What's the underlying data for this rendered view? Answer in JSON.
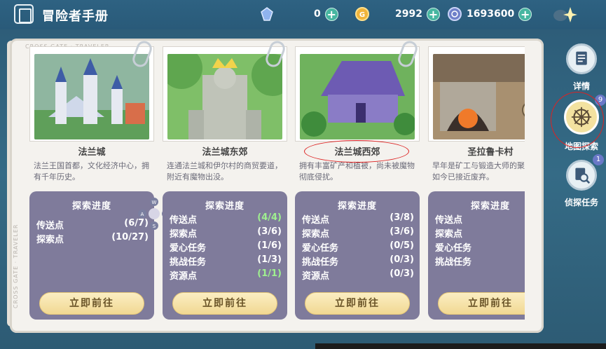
{
  "header": {
    "title": "冒险者手册",
    "resources": [
      {
        "icon": "crystal-icon",
        "value": "0"
      },
      {
        "icon": "gold-coin-icon",
        "value": "2992"
      },
      {
        "icon": "silver-coin-icon",
        "value": "1693600"
      }
    ]
  },
  "watermark": "CROSS GATE · TRAVELER",
  "labels": {
    "progress": "探索进度",
    "go": "立即前往"
  },
  "cards": [
    {
      "name": "法兰城",
      "desc": "法兰王国首都，文化经济中心，拥有千年历史。",
      "rows": [
        {
          "label": "传送点",
          "value": "(6/7)",
          "complete": false
        },
        {
          "label": "探索点",
          "value": "(10/27)",
          "complete": false
        }
      ]
    },
    {
      "name": "法兰城东郊",
      "desc": "连通法兰城和伊尔村的商贸要道，附近有魔物出没。",
      "rows": [
        {
          "label": "传送点",
          "value": "(4/4)",
          "complete": true
        },
        {
          "label": "探索点",
          "value": "(3/6)",
          "complete": false
        },
        {
          "label": "爱心任务",
          "value": "(1/6)",
          "complete": false
        },
        {
          "label": "挑战任务",
          "value": "(1/3)",
          "complete": false
        },
        {
          "label": "资源点",
          "value": "(1/1)",
          "complete": true
        }
      ]
    },
    {
      "name": "法兰城西郊",
      "desc": "拥有丰富矿产和植被，尚未被魔物彻底侵扰。",
      "rows": [
        {
          "label": "传送点",
          "value": "(3/8)",
          "complete": false
        },
        {
          "label": "探索点",
          "value": "(3/6)",
          "complete": false
        },
        {
          "label": "爱心任务",
          "value": "(0/5)",
          "complete": false
        },
        {
          "label": "挑战任务",
          "value": "(0/3)",
          "complete": false
        },
        {
          "label": "资源点",
          "value": "(0/3)",
          "complete": false
        }
      ]
    },
    {
      "name": "圣拉鲁卡村",
      "desc": "早年是矿工与锻造大师的聚居地，如今已接近废弃。",
      "rows": [
        {
          "label": "传送点",
          "value": "(",
          "complete": false
        },
        {
          "label": "探索点",
          "value": "(",
          "complete": false
        },
        {
          "label": "爱心任务",
          "value": "(",
          "complete": false
        },
        {
          "label": "挑战任务",
          "value": "(",
          "complete": false
        }
      ]
    }
  ],
  "side_menu": [
    {
      "label": "详情",
      "icon": "document-icon",
      "badge": ""
    },
    {
      "label": "地图探索",
      "icon": "compass-wheel-icon",
      "badge": "9"
    },
    {
      "label": "侦探任务",
      "icon": "magnifier-icon",
      "badge": "1"
    }
  ]
}
